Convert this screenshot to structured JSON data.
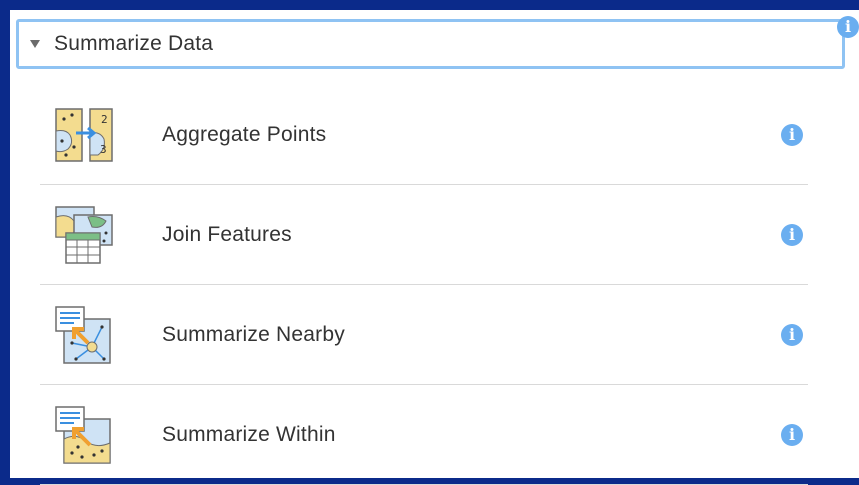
{
  "section": {
    "title": "Summarize Data",
    "info_glyph": "i",
    "caret_icon": "caret-down-icon"
  },
  "tools": [
    {
      "label": "Aggregate Points",
      "icon": "aggregate-points-icon",
      "info_glyph": "i"
    },
    {
      "label": "Join Features",
      "icon": "join-features-icon",
      "info_glyph": "i"
    },
    {
      "label": "Summarize Nearby",
      "icon": "summarize-nearby-icon",
      "info_glyph": "i"
    },
    {
      "label": "Summarize Within",
      "icon": "summarize-within-icon",
      "info_glyph": "i"
    }
  ],
  "colors": {
    "background": "#0b2a8a",
    "header_border": "#8fc3f3",
    "info_icon": "#6aaef0",
    "text": "#333333",
    "divider": "#d9d9d9"
  }
}
